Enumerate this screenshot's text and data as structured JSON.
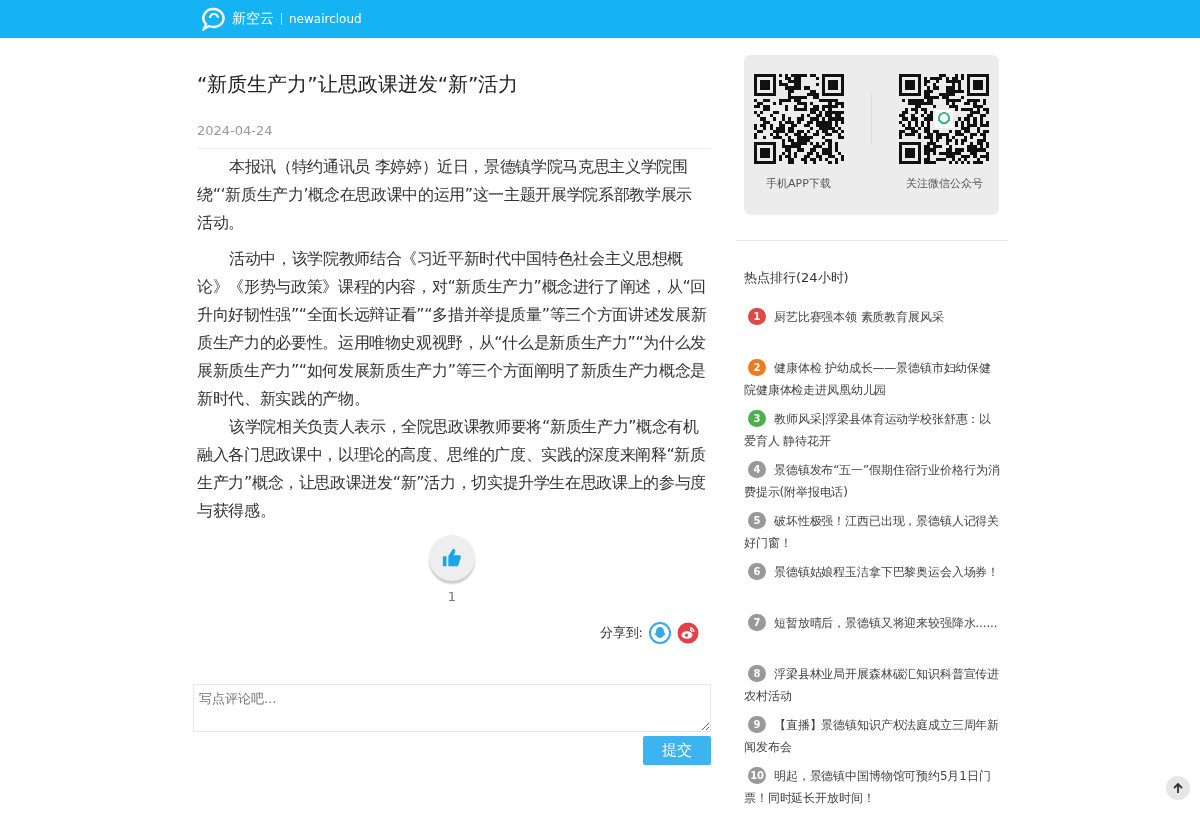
{
  "header": {
    "brand_cn": "新空云",
    "brand_en": "newaircloud"
  },
  "article": {
    "title": "“新质生产力”让思政课迸发“新”活力",
    "date": "2024-04-24",
    "paragraphs": [
      {
        "text": "本报讯（特约通讯员 李婷婷）近日，景德镇学院马克思主义学院围绕“‘新质生产力’概念在思政课中的运用”这一主题开展学院系部教学展示活动。"
      },
      {
        "text": "活动中，该学院教师结合《习近平新时代中国特色社会主义思想概论》《形势与政策》课程的内容，对“新质生产力”概念进行了阐述，从“回升向好韧性强”“全面长远辩证看”“多措并举提质量”等三个方面讲述发展新质生产力的必要性。运用唯物史观视野，从“什么是新质生产力”“为什么发展新质生产力”“如何发展新质生产力”等三个方面阐明了新质生产力概念是新时代、新实践的产物。"
      },
      {
        "text": "该学院相关负责人表示，全院思政课教师要将“新质生产力”概念有机融入各门思政课中，以理论的高度、思维的广度、实践的深度来阐释“新质生产力”概念，让思政课迸发“新”活力，切实提升学生在思政课上的参与度与获得感。"
      }
    ],
    "like_count": "1",
    "share_label": "分享到:"
  },
  "comment": {
    "placeholder": "写点评论吧...",
    "submit": "提交"
  },
  "sidebar": {
    "qr_codes": [
      {
        "label": "手机APP下载",
        "logo": false
      },
      {
        "label": "关注微信公众号",
        "logo": true
      }
    ],
    "hot_title": "热点排行(24小时)",
    "hot_items": [
      {
        "rank": "1",
        "color": "#e04848",
        "title": "厨艺比赛强本领 素质教育展风采"
      },
      {
        "rank": "2",
        "color": "#f07b1f",
        "title": "健康体检 护幼成长——景德镇市妇幼保健院健康体检走进凤凰幼儿园"
      },
      {
        "rank": "3",
        "color": "#4cb050",
        "title": "教师风采|浮梁县体育运动学校张舒惠：以爱育人 静待花开"
      },
      {
        "rank": "4",
        "color": "#999999",
        "title": "景德镇发布“五一”假期住宿行业价格行为消费提示(附举报电话)"
      },
      {
        "rank": "5",
        "color": "#999999",
        "title": "破坏性极强！江西已出现，景德镇人记得关好门窗！"
      },
      {
        "rank": "6",
        "color": "#999999",
        "title": "景德镇姑娘程玉洁拿下巴黎奥运会入场券！"
      },
      {
        "rank": "7",
        "color": "#999999",
        "title": "短暂放晴后，景德镇又将迎来较强降水......"
      },
      {
        "rank": "8",
        "color": "#999999",
        "title": "浮梁县林业局开展森林碳汇知识科普宣传进农村活动"
      },
      {
        "rank": "9",
        "color": "#999999",
        "title": "【直播】景德镇知识产权法庭成立三周年新闻发布会"
      },
      {
        "rank": "10",
        "color": "#999999",
        "title": "明起，景德镇中国博物馆可预约5月1日门票！同时延长开放时间！"
      }
    ]
  }
}
